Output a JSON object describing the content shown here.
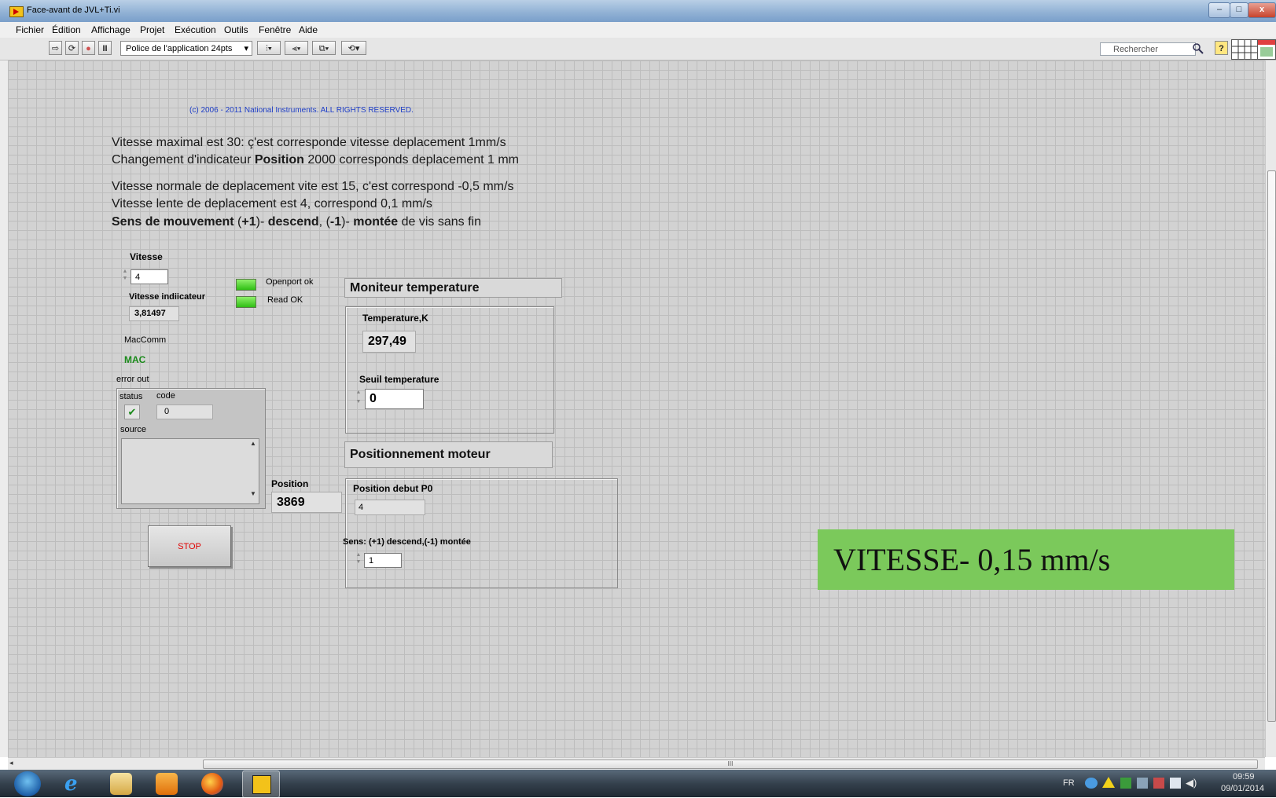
{
  "window": {
    "title": "Face-avant de JVL+Ti.vi",
    "min": "–",
    "max": "□",
    "close": "x"
  },
  "menu": [
    "Fichier",
    "Édition",
    "Affichage",
    "Projet",
    "Exécution",
    "Outils",
    "Fenêtre",
    "Aide"
  ],
  "toolbar": {
    "run": "⇨",
    "run_cont": "⟳",
    "abort": "●",
    "pause": "II",
    "font": "Police de l'application 24pts",
    "font_arrow": "▾",
    "align": "⫶▾",
    "distribute": "⫷▾",
    "resize": "⧉▾",
    "reorder": "⟲▾",
    "search_placeholder": "Rechercher",
    "help": "?"
  },
  "panel": {
    "copyright": "(c) 2006 - 2011 National Instruments.  ALL RIGHTS RESERVED.",
    "line1": "Vitesse maximal est 30:   ç'est corresponde vitesse deplacement  1mm/s",
    "line2_pre": "Changement d'indicateur ",
    "line2_bold": "Position",
    "line2_post": " 2000 corresponds deplacement 1 mm",
    "line3": "Vitesse normale de deplacement vite est 15, c'est correspond -0,5 mm/s",
    "line4": "Vitesse lente de deplacement est  4, correspond 0,1 mm/s",
    "line5_a": "Sens de mouvement",
    "line5_b": " (",
    "line5_c": "+1",
    "line5_d": ")- ",
    "line5_e": "descend",
    "line5_f": ", (",
    "line5_g": "-1",
    "line5_h": ")- ",
    "line5_i": "montée",
    "line5_j": " de vis sans fin"
  },
  "controls": {
    "vitesse_label": "Vitesse",
    "vitesse_value": "4",
    "vitesse_ind_label": "Vitesse indiicateur",
    "vitesse_ind_value": "3,81497",
    "openport_label": "Openport ok",
    "readok_label": "Read OK",
    "maccomm_label": "MacComm",
    "maccomm_value": "MAC",
    "error_out_label": "error out",
    "status_label": "status",
    "code_label": "code",
    "code_value": "0",
    "status_check": "✔",
    "source_label": "source",
    "position_label": "Position",
    "position_value": "3869",
    "stop_label": "STOP"
  },
  "temperature": {
    "header": "Moniteur temperature",
    "temp_label": "Temperature,K",
    "temp_value": "297,49",
    "seuil_label": "Seuil temperature",
    "seuil_value": "0"
  },
  "moteur": {
    "header": "Positionnement moteur",
    "p0_label": "Position debut P0",
    "p0_value": "4",
    "sens_label": "Sens: (+1) descend,(-1) montée",
    "sens_value": "1"
  },
  "banner": {
    "text": "VITESSE- 0,15 mm/s",
    "color": "#7bc95b"
  },
  "scroll": {
    "h_thumb": "III"
  },
  "taskbar": {
    "lang": "FR",
    "time": "09:59",
    "date": "09/01/2014",
    "icons": [
      "windows-start",
      "internet-explorer",
      "file-explorer",
      "media-player",
      "firefox",
      "labview"
    ]
  }
}
